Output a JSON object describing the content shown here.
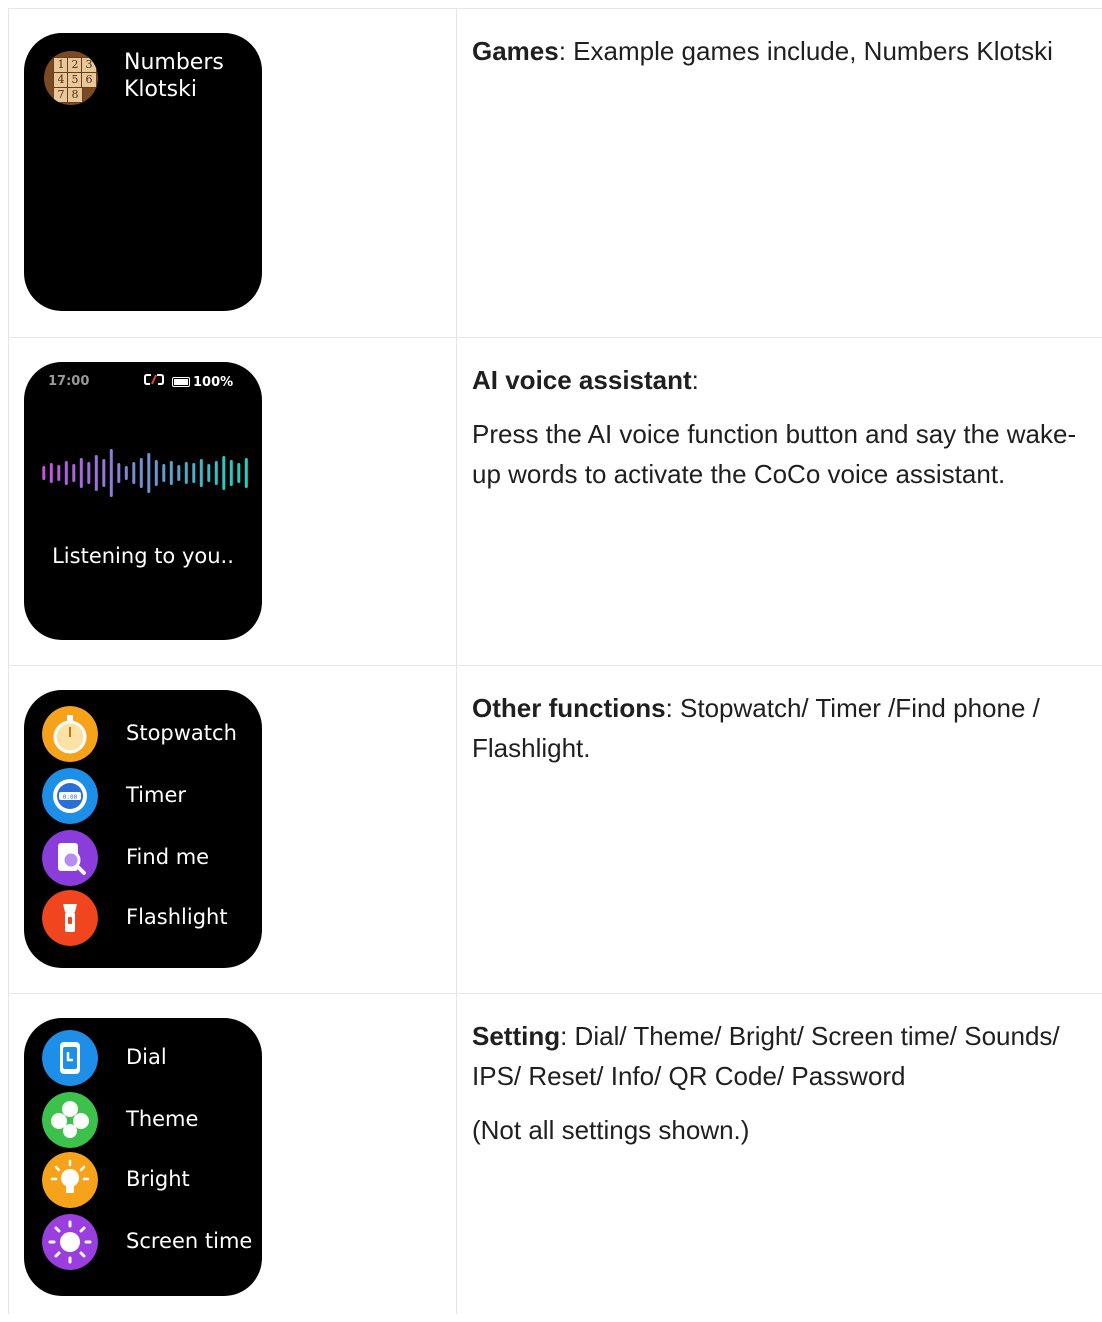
{
  "rows": [
    {
      "watch": {
        "title_line1": "Numbers",
        "title_line2": "Klotski",
        "tiles": [
          "1",
          "2",
          "3",
          "4",
          "5",
          "6",
          "7",
          "8"
        ]
      },
      "description": {
        "bold": "Games",
        "text": ": Example games include, Numbers Klotski"
      }
    },
    {
      "watch": {
        "status_time": "17:00",
        "battery": "100%",
        "listening": "Listening to you.."
      },
      "description": {
        "bold": "AI voice assistant",
        "text": ":",
        "paragraph": "Press the AI voice function button and say the wake-up words to activate the CoCo voice assistant."
      }
    },
    {
      "watch": {
        "items": [
          {
            "label": "Stopwatch",
            "icon": "stopwatch-icon",
            "color": "#f7a21b"
          },
          {
            "label": "Timer",
            "icon": "timer-icon",
            "color": "#1e8fe8"
          },
          {
            "label": "Find me",
            "icon": "find-phone-icon",
            "color": "#8b3ddc"
          },
          {
            "label": "Flashlight",
            "icon": "flashlight-icon",
            "color": "#f0451e"
          }
        ]
      },
      "description": {
        "bold": "Other functions",
        "text": ": Stopwatch/ Timer /Find phone / Flashlight."
      }
    },
    {
      "watch": {
        "items": [
          {
            "label": "Dial",
            "icon": "watch-dial-icon",
            "color": "#1e8fe8"
          },
          {
            "label": "Theme",
            "icon": "theme-icon",
            "color": "#3cc24a"
          },
          {
            "label": "Bright",
            "icon": "bulb-icon",
            "color": "#f7a21b"
          },
          {
            "label": "Screen time",
            "icon": "sun-icon",
            "color": "#9b3ee0"
          }
        ]
      },
      "description": {
        "bold": "Setting",
        "text": ": Dial/ Theme/ Bright/ Screen time/ Sounds/ IPS/ Reset/ Info/ QR Code/ Password",
        "paragraph": "(Not all settings shown.)"
      }
    }
  ]
}
